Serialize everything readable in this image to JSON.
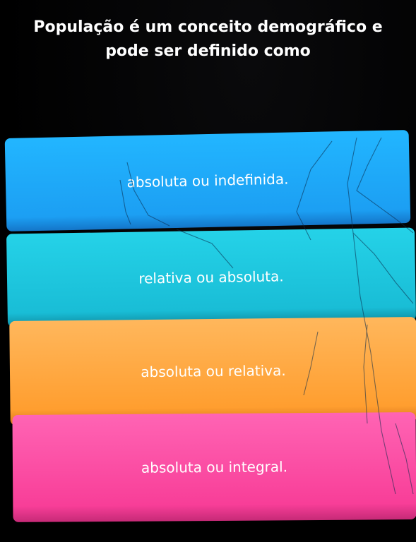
{
  "question": {
    "line1": "População é um conceito demográfico e",
    "line2": "pode ser definido como"
  },
  "options": [
    {
      "label": "absoluta ou indefinida.",
      "color": "#1c9ff3"
    },
    {
      "label": "relativa ou absoluta.",
      "color": "#19bdd6"
    },
    {
      "label": "absoluta ou relativa.",
      "color": "#ff9e2f"
    },
    {
      "label": "absoluta ou integral.",
      "color": "#f83e98"
    }
  ]
}
